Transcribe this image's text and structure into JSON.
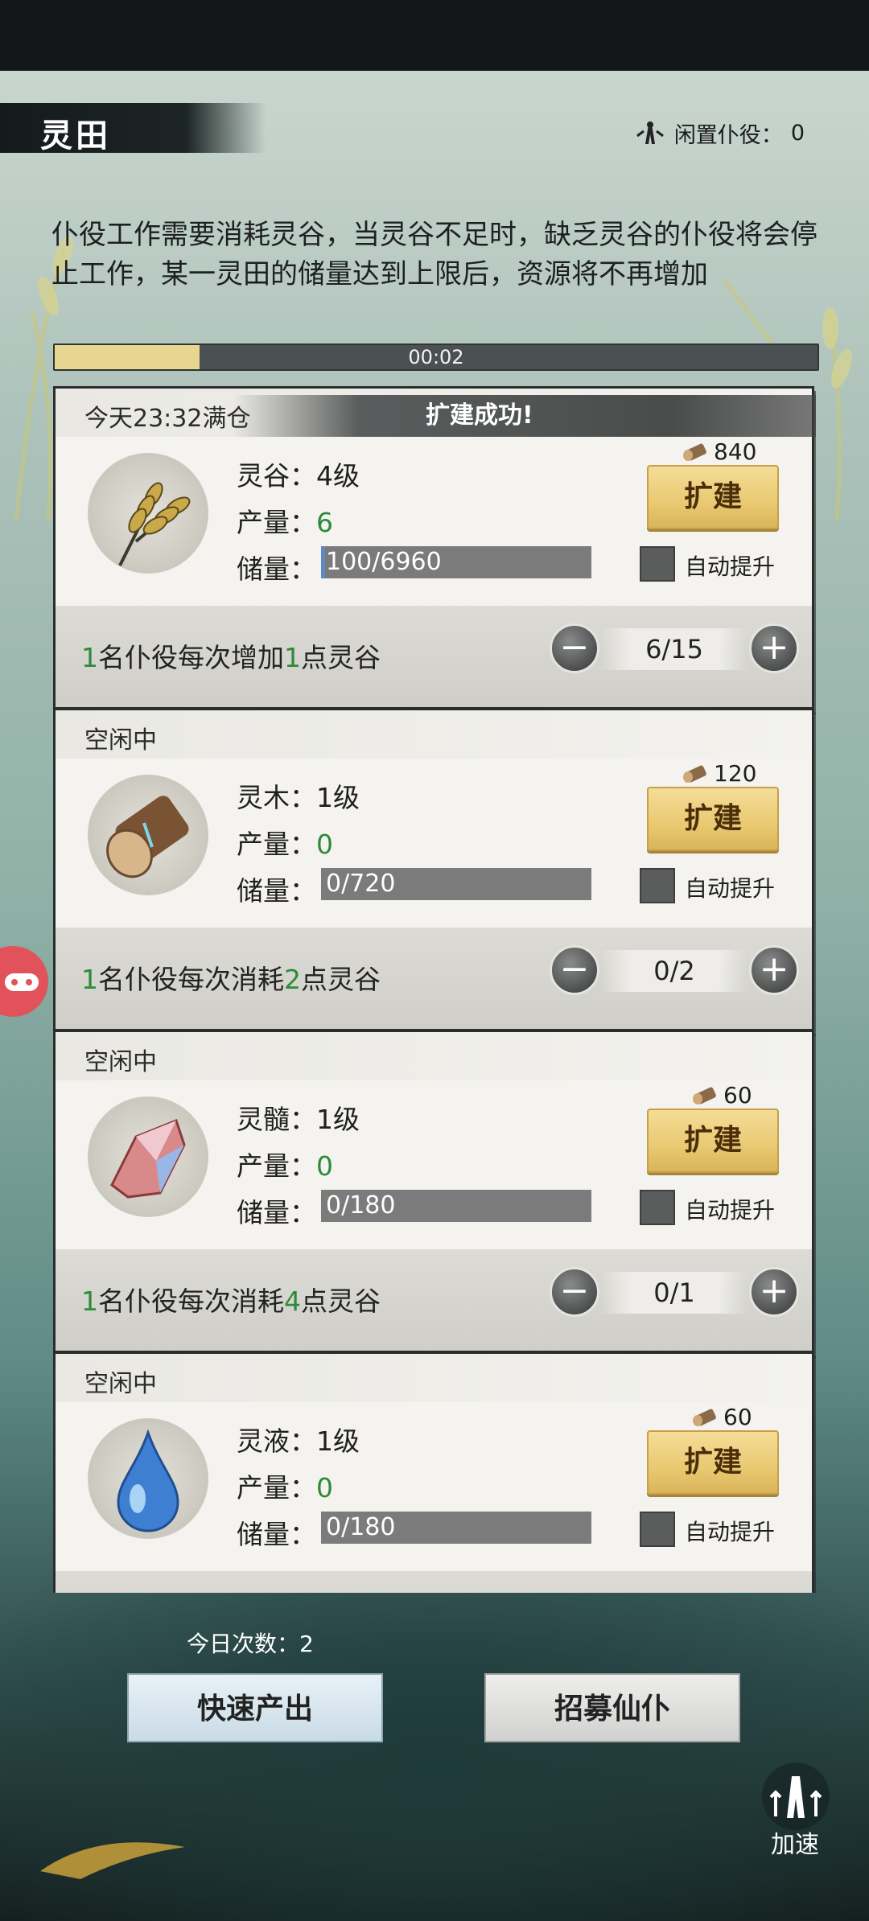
{
  "header": {
    "title": "灵田",
    "idle_label": "闲置仆役：",
    "idle_count": "0"
  },
  "description": "仆役工作需要消耗灵谷，当灵谷不足时，缺乏灵谷的仆役将会停止工作，某一灵田的储量达到上限后，资源将不再增加",
  "timer": {
    "label": "00:02",
    "progress": 0.19
  },
  "cards": [
    {
      "status": "今天23:32满仓",
      "banner": "扩建成功!",
      "resource_label": "灵谷：",
      "level": "4级",
      "output_label": "产量：",
      "output": "6",
      "storage_label": "储量：",
      "storage": "100/6960",
      "storage_fraction": 0.014,
      "cost": "840",
      "expand_label": "扩建",
      "auto_label": "自动提升",
      "foot": {
        "n1": "1",
        "t1": "名仆役每次增加",
        "n2": "1",
        "t2": "点灵谷"
      },
      "workers": "6/15",
      "icon": "grain-icon"
    },
    {
      "status": "空闲中",
      "resource_label": "灵木：",
      "level": "1级",
      "output_label": "产量：",
      "output": "0",
      "storage_label": "储量：",
      "storage": "0/720",
      "storage_fraction": 0,
      "cost": "120",
      "expand_label": "扩建",
      "auto_label": "自动提升",
      "foot": {
        "n1": "1",
        "t1": "名仆役每次消耗",
        "n2": "2",
        "t2": "点灵谷"
      },
      "workers": "0/2",
      "icon": "wood-log-icon"
    },
    {
      "status": "空闲中",
      "resource_label": "灵髓：",
      "level": "1级",
      "output_label": "产量：",
      "output": "0",
      "storage_label": "储量：",
      "storage": "0/180",
      "storage_fraction": 0,
      "cost": "60",
      "expand_label": "扩建",
      "auto_label": "自动提升",
      "foot": {
        "n1": "1",
        "t1": "名仆役每次消耗",
        "n2": "4",
        "t2": "点灵谷"
      },
      "workers": "0/1",
      "icon": "crystal-icon"
    },
    {
      "status": "空闲中",
      "resource_label": "灵液：",
      "level": "1级",
      "output_label": "产量：",
      "output": "0",
      "storage_label": "储量：",
      "storage": "0/180",
      "storage_fraction": 0,
      "cost": "60",
      "expand_label": "扩建",
      "auto_label": "自动提升",
      "icon": "water-drop-icon"
    }
  ],
  "bottom": {
    "today_label": "今日次数：",
    "today_count": "2",
    "fast_output": "快速产出",
    "recruit": "招募仙仆",
    "speed_up": "加速"
  }
}
